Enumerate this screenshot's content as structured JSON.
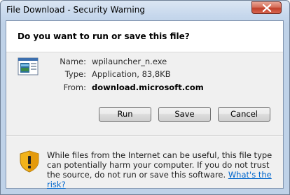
{
  "window": {
    "title": "File Download - Security Warning"
  },
  "header": {
    "question": "Do you want to run or save this file?"
  },
  "file_info": {
    "name_label": "Name:",
    "name_value": "wpilauncher_n.exe",
    "type_label": "Type:",
    "type_value": "Application, 83,8KB",
    "from_label": "From:",
    "from_value": "download.microsoft.com"
  },
  "buttons": {
    "run": "Run",
    "save": "Save",
    "cancel": "Cancel"
  },
  "warning": {
    "text": "While files from the Internet can be useful, this file type can potentially harm your computer. If you do not trust the source, do not run or save this software.",
    "link": "What's the risk?"
  },
  "icons": {
    "close": "close-icon",
    "file": "application-file-icon",
    "warning": "security-shield-warning-icon"
  },
  "colors": {
    "link": "#0066cc",
    "close_button": "#c0402a",
    "shield": "#f2b31a"
  }
}
